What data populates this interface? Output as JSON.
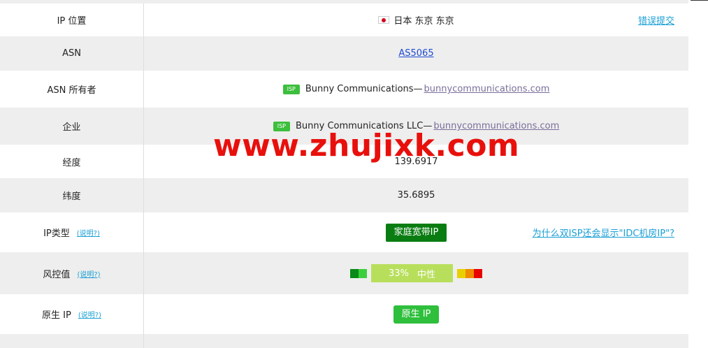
{
  "rows": {
    "ip_location": {
      "label": "IP 位置",
      "value": "日本 东京 东京",
      "right_link": "错误提交"
    },
    "asn": {
      "label": "ASN",
      "value": "AS5065"
    },
    "asn_owner": {
      "label": "ASN 所有者",
      "badge": "ISP",
      "name": "Bunny Communications—",
      "domain": "bunnycommunications.com"
    },
    "company": {
      "label": "企业",
      "badge": "ISP",
      "name": "Bunny Communications LLC—",
      "domain": "bunnycommunications.com"
    },
    "longitude": {
      "label": "经度",
      "value": "139.6917"
    },
    "latitude": {
      "label": "纬度",
      "value": "35.6895"
    },
    "ip_type": {
      "label": "IP类型",
      "help": "(说明?)",
      "value": "家庭宽带IP",
      "right_link": "为什么双ISP还会显示\"IDC机房IP\"?"
    },
    "risk": {
      "label": "风控值",
      "help": "(说明?)",
      "percent": "33%",
      "level": "中性",
      "score": 0.33
    },
    "native_ip": {
      "label": "原生 IP",
      "help": "(说明?)",
      "value": "原生 IP"
    }
  },
  "colors": {
    "risk_low_dark": "#0a8a18",
    "risk_low_light": "#3ccf3c",
    "risk_mid": "#b8df5c",
    "risk_high_1": "#e8d000",
    "risk_high_2": "#f08a00",
    "risk_high_3": "#e80000"
  },
  "icons": {
    "flag": "japan-flag-icon"
  },
  "watermark": "www.zhujixk.com"
}
